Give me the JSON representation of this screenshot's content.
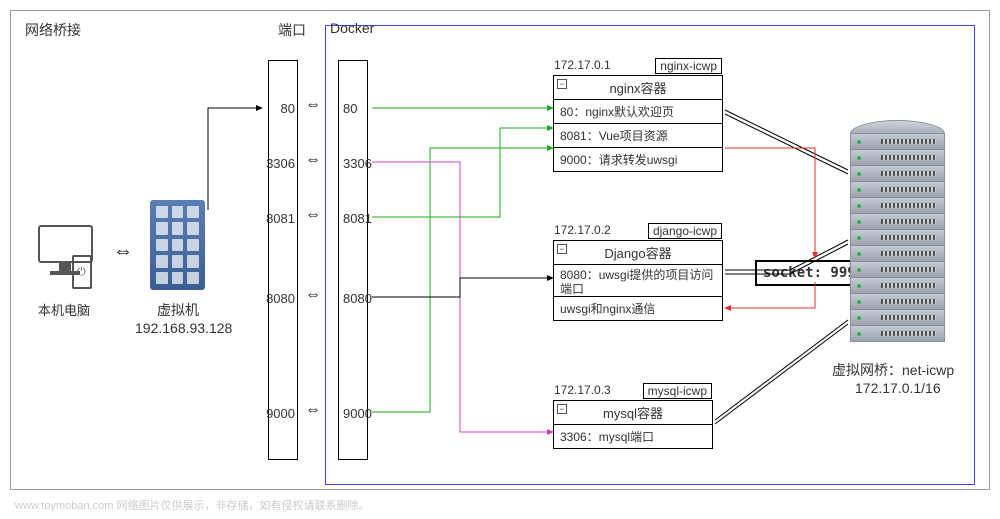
{
  "title": "网络桥接",
  "ports_label": "端口",
  "docker_label": "Docker",
  "computer_label": "本机电脑",
  "vm_label": "虚拟机",
  "vm_ip": "192.168.93.128",
  "port_map": {
    "p1": {
      "host": "80",
      "cont": "80"
    },
    "p2": {
      "host": "3306",
      "cont": "3306"
    },
    "p3": {
      "host": "8081",
      "cont": "8081"
    },
    "p4": {
      "host": "8080",
      "cont": "8080"
    },
    "p5": {
      "host": "9000",
      "cont": "9000"
    }
  },
  "nginx": {
    "ip": "172.17.0.1",
    "name": "nginx-icwp",
    "title": "nginx容器",
    "r1": "80：nginx默认欢迎页",
    "r2": "8081：Vue项目资源",
    "r3": "9000：请求转发uwsgi"
  },
  "django": {
    "ip": "172.17.0.2",
    "name": "django-icwp",
    "title": "Django容器",
    "r1": "8080：uwsgi提供的项目访问端口",
    "r2": "uwsgi和nginx通信"
  },
  "mysql": {
    "ip": "172.17.0.3",
    "name": "mysql-icwp",
    "title": "mysql容器",
    "r1": "3306：mysql端口"
  },
  "socket": "socket: 9999",
  "bridge_label": "虚拟网桥：net-icwp",
  "bridge_cidr": "172.17.0.1/16",
  "watermark": "www.toymoban.com 网络图片仅供展示，非存储，如有侵权请联系删除。",
  "collapse_glyph": "−"
}
